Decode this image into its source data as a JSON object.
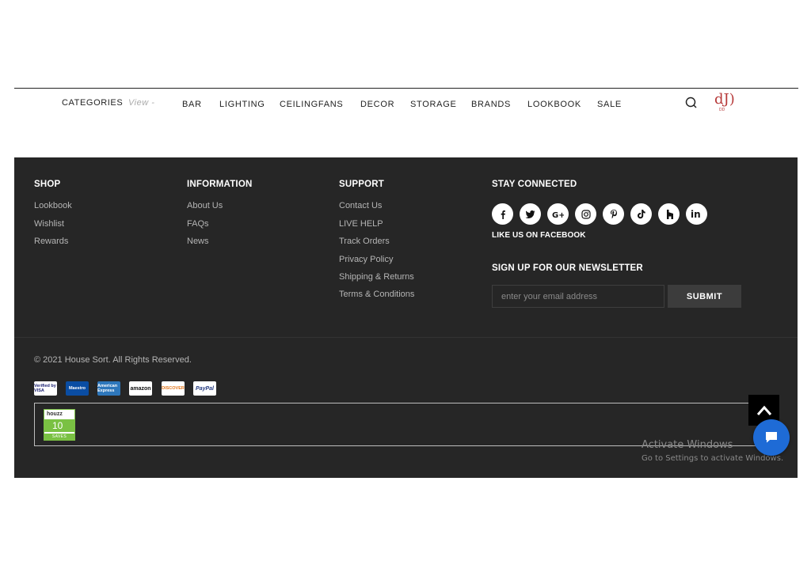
{
  "nav": {
    "categories": "CATEGORIES",
    "view": "View -",
    "items": [
      "BAR",
      "LIGHTING",
      "CEILINGFANS",
      "DECOR",
      "STORAGE",
      "BRANDS",
      "LOOKBOOK",
      "SALE"
    ],
    "logo": "dJ)",
    "logo_sub": "DD"
  },
  "footer": {
    "shop": {
      "title": "SHOP",
      "links": [
        "Lookbook",
        "Wishlist",
        "Rewards"
      ]
    },
    "information": {
      "title": "INFORMATION",
      "links": [
        "About Us",
        "FAQs",
        "News"
      ]
    },
    "support": {
      "title": "SUPPORT",
      "links": [
        "Contact Us",
        "LIVE HELP",
        "Track Orders",
        "Privacy Policy",
        "Shipping & Returns",
        "Terms & Conditions"
      ]
    },
    "connected": {
      "title": "STAY CONNECTED",
      "social_icons": [
        "facebook-icon",
        "twitter-icon",
        "google-plus-icon",
        "instagram-icon",
        "pinterest-icon",
        "tiktok-icon",
        "houzz-icon",
        "linkedin-icon"
      ],
      "like_us": "LIKE US ON FACEBOOK"
    },
    "newsletter": {
      "title": "SIGN UP FOR OUR NEWSLETTER",
      "placeholder": "enter your email address",
      "submit": "SUBMIT"
    },
    "copyright": "© 2021 House Sort. All Rights Reserved.",
    "payments": [
      "Verified by VISA",
      "Maestro",
      "American Express",
      "amazon",
      "DISCOVER",
      "PayPal"
    ],
    "houzz_badge": {
      "brand": "houzz",
      "count": "10",
      "label": "SAVES"
    }
  },
  "windows": {
    "line1": "Activate Windows",
    "line2": "Go to Settings to activate Windows."
  },
  "colors": {
    "footer_bg": "#262626",
    "logo": "#b73a3a",
    "chat": "#1e6bd6",
    "houzz_green": "#7ac143"
  }
}
